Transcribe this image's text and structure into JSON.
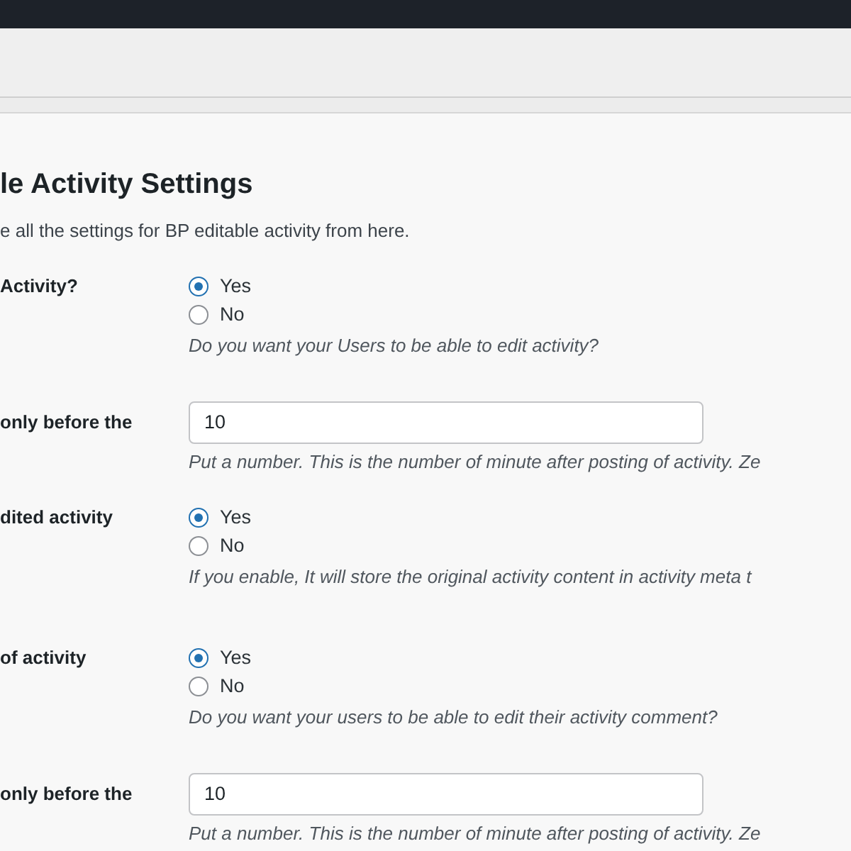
{
  "heading": "le Activity Settings",
  "description": "e all the settings for BP editable activity from here.",
  "settings": [
    {
      "kind": "radio",
      "label": "Activity?",
      "options": [
        {
          "label": "Yes",
          "selected": true
        },
        {
          "label": "No",
          "selected": false
        }
      ],
      "hint": "Do you want your Users to be able to edit activity?"
    },
    {
      "kind": "number",
      "label": "only before the",
      "value": "10",
      "hint": "Put a number. This is the number of minute after posting of activity. Ze"
    },
    {
      "kind": "radio",
      "label": "dited activity",
      "options": [
        {
          "label": "Yes",
          "selected": true
        },
        {
          "label": "No",
          "selected": false
        }
      ],
      "hint": "If you enable, It will store the original activity content in activity meta t"
    },
    {
      "kind": "radio",
      "label": "of activity",
      "options": [
        {
          "label": "Yes",
          "selected": true
        },
        {
          "label": "No",
          "selected": false
        }
      ],
      "hint": "Do you want your users to be able to edit their activity comment?"
    },
    {
      "kind": "number",
      "label": "only before the",
      "value": "10",
      "hint": "Put a number. This is the number of minute after posting of activity. Ze"
    }
  ]
}
